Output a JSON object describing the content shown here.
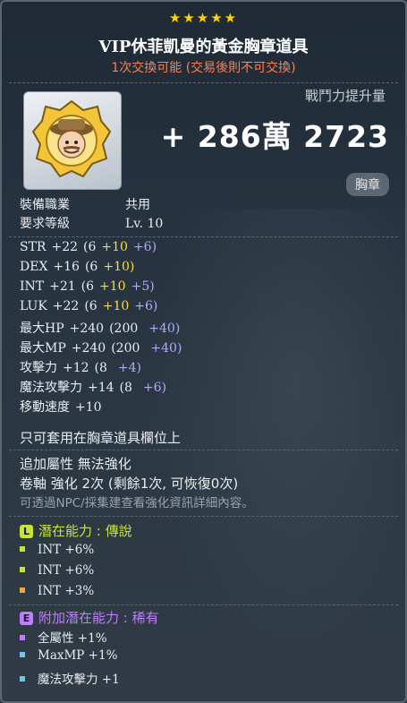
{
  "item": {
    "stars": "★★★★★",
    "name": "VIP休菲凱曼的黃金胸章道具",
    "trade_note": "1次交換可能 (交易後則不可交換)",
    "combat_power_label": "戰鬥力提升量",
    "combat_power_value": "+ 286萬 2723",
    "category": "胸章",
    "job_label": "裝備職業",
    "job_value": "共用",
    "level_label": "要求等級",
    "level_value": "Lv. 10"
  },
  "stats": [
    {
      "name": "STR",
      "total": "+22",
      "base": "(6",
      "y": "+10",
      "p": "+6)"
    },
    {
      "name": "DEX",
      "total": "+16",
      "base": "(6",
      "y": "+10)",
      "p": ""
    },
    {
      "name": "INT",
      "total": "+21",
      "base": "(6",
      "y": "+10",
      "p": "+5)"
    },
    {
      "name": "LUK",
      "total": "+22",
      "base": "(6",
      "y": "+10",
      "p": "+6)"
    },
    {
      "name": "最大HP",
      "total": "+240",
      "base": "(200",
      "y": "",
      "p": "+40)"
    },
    {
      "name": "最大MP",
      "total": "+240",
      "base": "(200",
      "y": "",
      "p": "+40)"
    },
    {
      "name": "攻擊力",
      "total": "+12",
      "base": "(8",
      "y": "",
      "p": "+4)"
    },
    {
      "name": "魔法攻擊力",
      "total": "+14",
      "base": "(8",
      "y": "",
      "p": "+6)"
    },
    {
      "name": "移動速度",
      "total": "+10",
      "base": "",
      "y": "",
      "p": ""
    }
  ],
  "slot_note": "只可套用在胸章道具欄位上",
  "upgrade": {
    "line1": "追加屬性 無法強化",
    "line2": "卷軸 強化 2次 (剩餘1次, 可恢復0次)",
    "line3": "可透過NPC/採集建查看強化資訊詳細內容。"
  },
  "potential": {
    "badge": "L",
    "title": "潛在能力 : 傳說",
    "color": "#c8e23c",
    "lines": [
      "INT +6%",
      "INT +6%",
      "INT +3%"
    ],
    "dot_colors": [
      "#c8e23c",
      "#c8e23c",
      "#f0a640"
    ]
  },
  "additional": {
    "badge": "E",
    "title": "附加潛在能力 : 稀有",
    "color": "#c07cff",
    "lines": [
      "全屬性 +1%",
      "MaxMP +1%",
      "魔法攻擊力 +1"
    ],
    "dot_colors": [
      "#c07cff",
      "#6ec6e8",
      "#6ec6e8"
    ]
  }
}
